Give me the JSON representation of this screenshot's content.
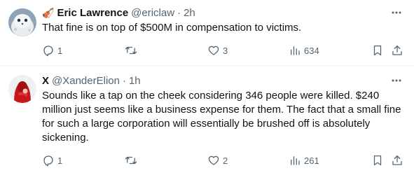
{
  "tweets": [
    {
      "emoji": "🎻",
      "display_name": "Eric Lawrence",
      "handle": "@ericlaw",
      "separator": "·",
      "time": "2h",
      "text": "That fine is on top of $500M in compensation to victims.",
      "replies": "1",
      "retweets": "",
      "likes": "3",
      "views": "634",
      "avatar_icon": "snowy-owl-avatar"
    },
    {
      "emoji": "",
      "display_name": "X",
      "handle": "@XanderElion",
      "separator": "·",
      "time": "1h",
      "text": "Sounds like a tap on the cheek considering 346 people were killed. $240 million just seems like a business expense for them. The fact that a small fine for such a large corporation will essentially be brushed off is absolutely sickening.",
      "replies": "1",
      "retweets": "",
      "likes": "2",
      "views": "261",
      "avatar_icon": "red-hooded-figure-avatar"
    }
  ],
  "colors": {
    "text_primary": "#0f1419",
    "text_secondary": "#536471",
    "divider": "#eff3f4"
  }
}
